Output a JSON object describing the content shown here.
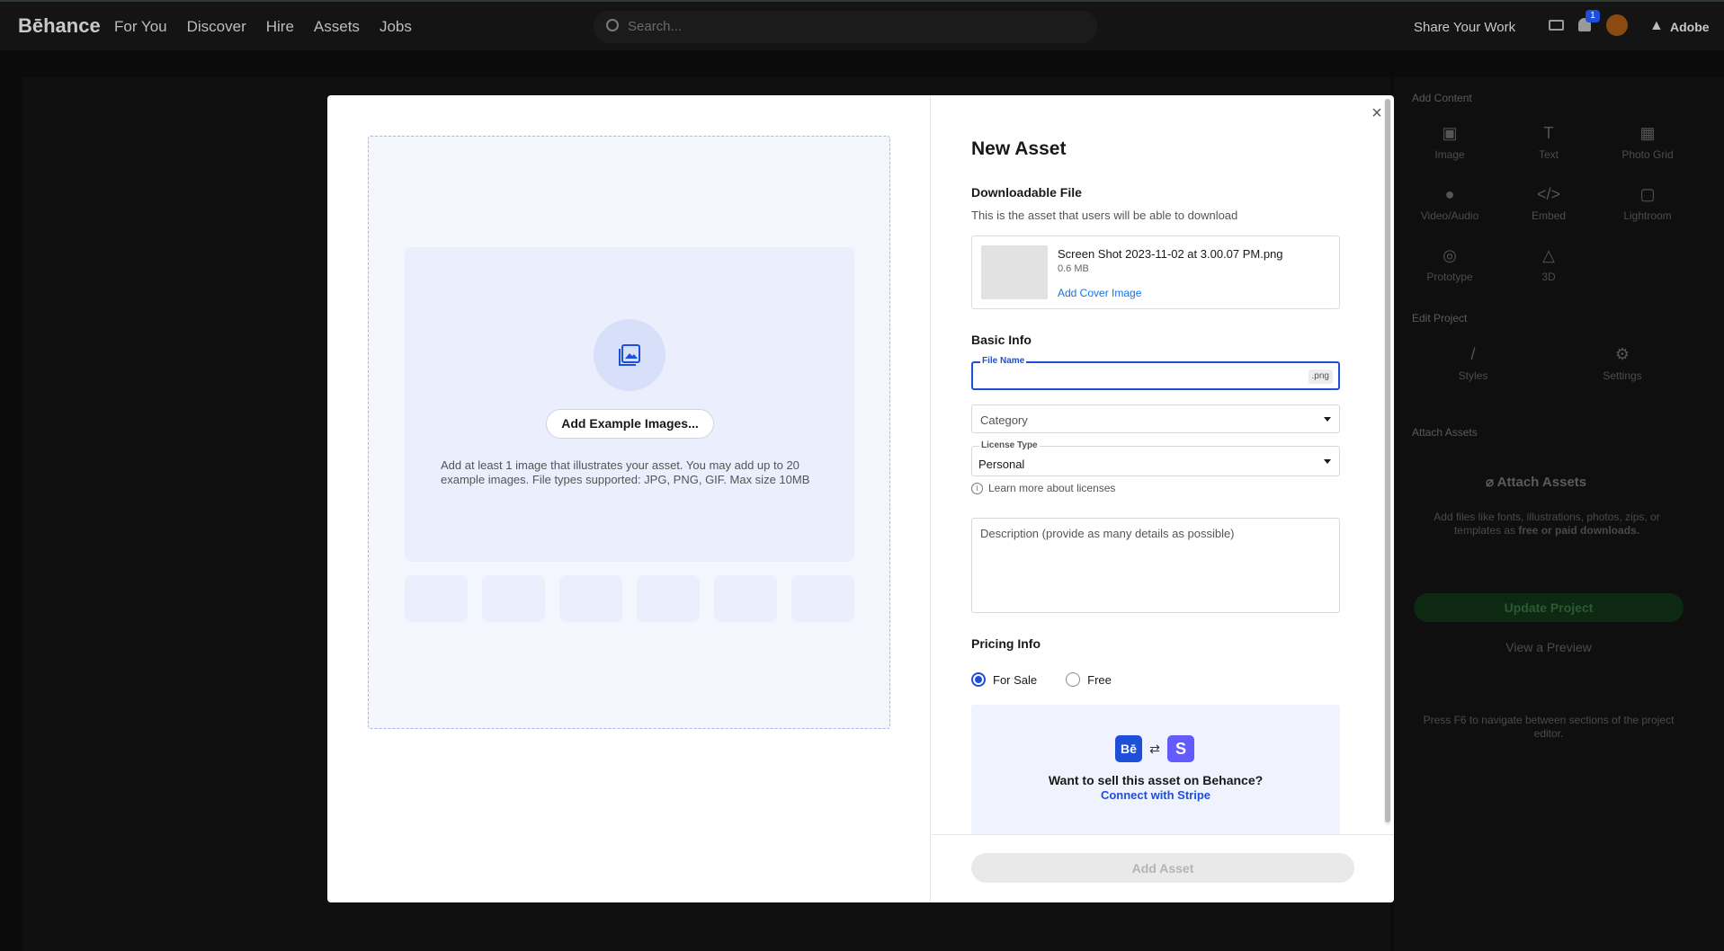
{
  "topbar": {
    "logo": "Bēhance",
    "nav": [
      "For You",
      "Discover",
      "Hire",
      "Assets",
      "Jobs"
    ],
    "search_placeholder": "Search...",
    "share_label": "Share Your Work",
    "notification_count": "1",
    "adobe_label": "Adobe"
  },
  "right_panel": {
    "add_content_heading": "Add Content",
    "tools": [
      "Image",
      "Text",
      "Photo Grid",
      "Video/Audio",
      "Embed",
      "Lightroom",
      "Prototype",
      "3D"
    ],
    "edit_project_heading": "Edit Project",
    "edit_tools": [
      "Styles",
      "Settings"
    ],
    "attach_heading": "Attach Assets",
    "attach_button": "Attach Assets",
    "attach_help_pre": "Add files like fonts, illustrations, photos, zips, or templates as ",
    "attach_help_bold": "free or paid downloads.",
    "update_button": "Update Project",
    "preview_link": "View a Preview",
    "f6_note": "Press F6 to navigate between sections of the project editor."
  },
  "modal": {
    "add_examples_button": "Add Example Images...",
    "examples_help": "Add at least 1 image that illustrates your asset. You may add up to 20 example images. File types supported: JPG, PNG, GIF. Max size 10MB",
    "close_label": "×",
    "title": "New Asset",
    "downloadable_heading": "Downloadable File",
    "downloadable_sub": "This is the asset that users will be able to download",
    "file": {
      "name": "Screen Shot 2023-11-02 at 3.00.07 PM.png",
      "size": "0.6 MB",
      "cover_link": "Add Cover Image"
    },
    "basic_info_heading": "Basic Info",
    "file_name_label": "File Name",
    "file_name_value": "",
    "file_ext": ".png",
    "category_placeholder": "Category",
    "license_label": "License Type",
    "license_value": "Personal",
    "license_info": "Learn more about licenses",
    "description_placeholder": "Description (provide as many details as possible)",
    "pricing_heading": "Pricing Info",
    "pricing_options": [
      "For Sale",
      "Free"
    ],
    "pricing_selected": "For Sale",
    "stripe": {
      "be_logo": "Bē",
      "swap_icon": "⇄",
      "s_logo": "S",
      "question": "Want to sell this asset on Behance?",
      "link": "Connect with Stripe"
    },
    "add_asset_button": "Add Asset"
  },
  "colors": {
    "accent": "#1d4fd9",
    "stripe": "#635bff",
    "overlay_bg": "#0b0b0b"
  }
}
